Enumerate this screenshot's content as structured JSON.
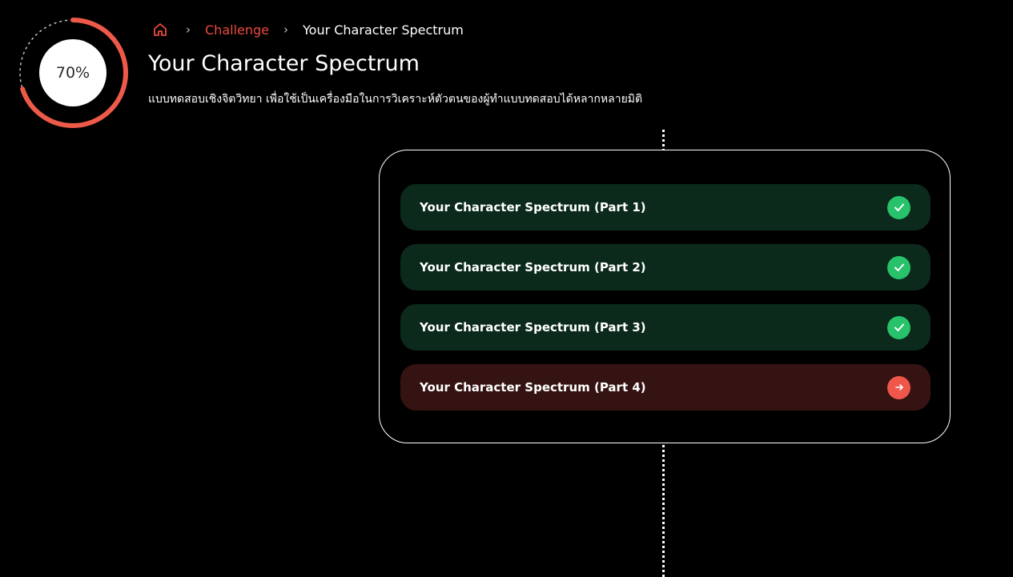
{
  "progress": {
    "value": 70,
    "label": "70%",
    "ring_color": "#ee5a4a",
    "track_color": "#c8c8c8"
  },
  "breadcrumb": {
    "home_icon": "home-icon",
    "separator": "›",
    "items": [
      {
        "label": "Challenge",
        "color": "#ee4b3f"
      },
      {
        "label": "Your Character Spectrum",
        "color": "#ffffff"
      }
    ]
  },
  "header": {
    "title": "Your Character Spectrum",
    "subtitle": "แบบทดสอบเชิงจิตวิทยา เพื่อใช้เป็นเครื่องมือในการวิเคราะห์ตัวตนของผู้ทำแบบทดสอบได้หลากหลายมิติ"
  },
  "parts": [
    {
      "label": "Your Character Spectrum (Part 1)",
      "status": "completed",
      "icon": "check-circle-icon"
    },
    {
      "label": "Your Character Spectrum (Part 2)",
      "status": "completed",
      "icon": "check-circle-icon"
    },
    {
      "label": "Your Character Spectrum (Part 3)",
      "status": "completed",
      "icon": "check-circle-icon"
    },
    {
      "label": "Your Character Spectrum (Part 4)",
      "status": "current",
      "icon": "arrow-right-circle-icon"
    }
  ],
  "colors": {
    "completed_bg": "#0b2a1b",
    "current_bg": "#361313",
    "check": "#27c26a",
    "accent": "#f0574b"
  }
}
